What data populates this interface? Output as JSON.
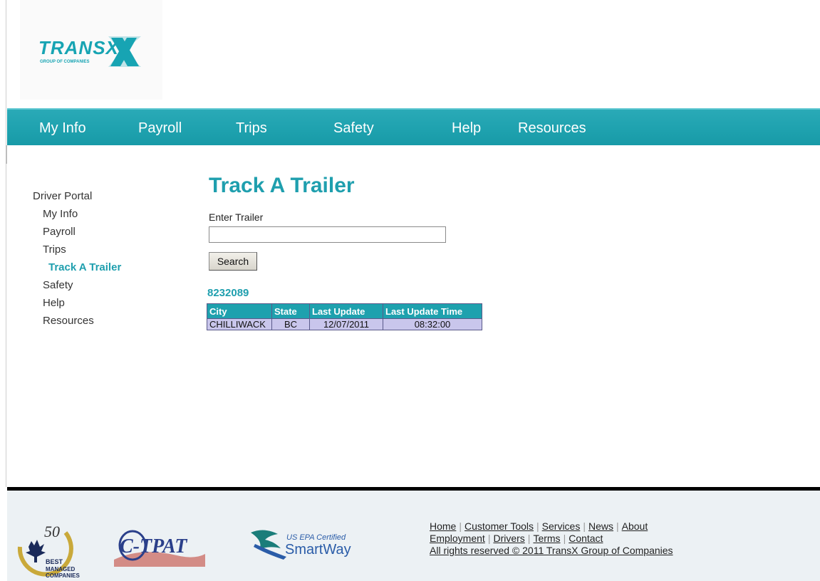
{
  "brand": {
    "logo_text": "TRANSX",
    "logo_sub": "GROUP OF COMPANIES",
    "color_primary": "#1ea1ae"
  },
  "nav": {
    "items": [
      {
        "label": "My Info"
      },
      {
        "label": "Payroll"
      },
      {
        "label": "Trips"
      },
      {
        "label": "Safety"
      },
      {
        "label": "Help"
      },
      {
        "label": "Resources"
      }
    ]
  },
  "sidebar": {
    "title": "Driver Portal",
    "items": [
      {
        "label": "My Info"
      },
      {
        "label": "Payroll"
      },
      {
        "label": "Trips"
      },
      {
        "label": "Track A Trailer",
        "active": true
      },
      {
        "label": "Safety"
      },
      {
        "label": "Help"
      },
      {
        "label": "Resources"
      }
    ]
  },
  "main": {
    "title": "Track A Trailer",
    "field_label": "Enter Trailer",
    "input_value": "",
    "search_label": "Search",
    "result_id": "8232089",
    "table": {
      "headers": [
        "City",
        "State",
        "Last Update",
        "Last Update Time"
      ],
      "rows": [
        [
          "CHILLIWACK",
          "BC",
          "12/07/2011",
          "08:32:00"
        ]
      ]
    }
  },
  "footer": {
    "badges": {
      "best_managed_number": "50",
      "best_managed_text": [
        "BEST",
        "MANAGED",
        "COMPANIES"
      ],
      "ctpat_text": "C-TPAT",
      "smartway_top": "US EPA Certified",
      "smartway_main": "SmartWay"
    },
    "links_row1": [
      "Home",
      "Customer Tools",
      "Services",
      "News",
      "About"
    ],
    "links_row2": [
      "Employment",
      "Drivers",
      "Terms",
      "Contact"
    ],
    "copyright": "All rights reserved © 2011 TransX Group of Companies"
  }
}
